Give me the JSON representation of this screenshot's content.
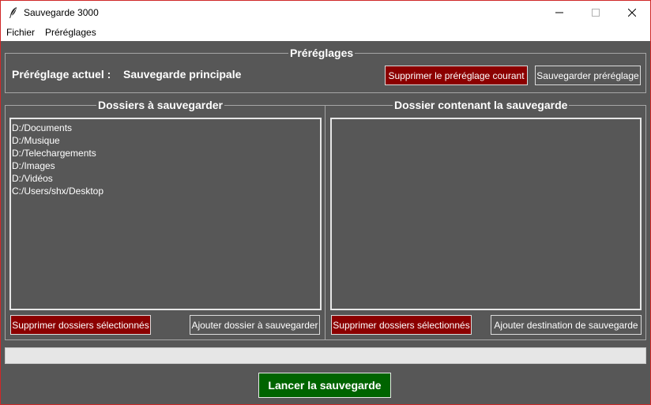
{
  "window": {
    "title": "Sauvegarde 3000"
  },
  "menu": {
    "items": [
      "Fichier",
      "Préréglages"
    ]
  },
  "presets": {
    "title": "Préréglages",
    "current_label": "Préréglage actuel :",
    "current_value": "Sauvegarde principale",
    "delete_button": "Supprimer le préréglage courant",
    "save_button": "Sauvegarder préréglage"
  },
  "source": {
    "title": "Dossiers à sauvegarder",
    "folders": [
      "D:/Documents",
      "D:/Musique",
      "D:/Telechargements",
      "D:/Images",
      "D:/Vidéos",
      "C:/Users/shx/Desktop"
    ],
    "delete_button": "Supprimer dossiers sélectionnés",
    "add_button": "Ajouter dossier à sauvegarder"
  },
  "destination": {
    "title": "Dossier contenant la sauvegarde",
    "folders": [],
    "delete_button": "Supprimer dossiers sélectionnés",
    "add_button": "Ajouter destination de sauvegarde"
  },
  "progress": {
    "value": 0
  },
  "launch_button": "Lancer la sauvegarde",
  "colors": {
    "background": "#575757",
    "danger": "#8b0000",
    "success": "#006400",
    "window_border": "#d02828"
  },
  "icons": {
    "app": "feather-icon",
    "minimize": "minimize-icon",
    "maximize": "maximize-icon",
    "close": "close-icon"
  }
}
